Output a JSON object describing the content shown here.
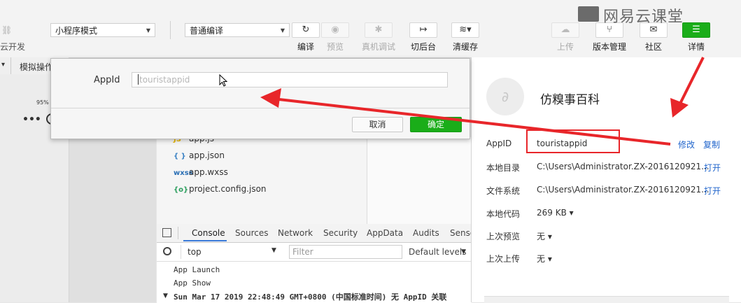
{
  "toolbar": {
    "left_partial_label": "云开发",
    "mode_select": "小程序模式",
    "compile_select": "普通编译",
    "buttons": [
      {
        "label": "编译",
        "icon": "refresh-icon",
        "disabled": false
      },
      {
        "label": "预览",
        "icon": "eye-icon",
        "disabled": true
      },
      {
        "label": "真机调试",
        "icon": "bug-icon",
        "disabled": true
      },
      {
        "label": "切后台",
        "icon": "switch-icon",
        "disabled": false
      },
      {
        "label": "清缓存",
        "icon": "layers-icon",
        "disabled": false
      }
    ],
    "right_buttons": [
      {
        "label": "上传",
        "icon": "cloud-upload-icon",
        "disabled": true
      },
      {
        "label": "版本管理",
        "icon": "branch-icon",
        "disabled": false
      },
      {
        "label": "社区",
        "icon": "chat-icon",
        "disabled": false
      },
      {
        "label": "详情",
        "icon": "menu-icon",
        "disabled": false
      }
    ]
  },
  "watermark": "网易云课堂",
  "simulator": {
    "ops_label": "模拟操作",
    "battery": "95%"
  },
  "dialog": {
    "label": "AppId",
    "placeholder": "touristappid",
    "cancel": "取消",
    "confirm": "确定"
  },
  "files": [
    {
      "icon": "JS",
      "name": "app.js",
      "color": "#e8b500"
    },
    {
      "icon": "{ }",
      "name": "app.json",
      "color": "#3b82c4"
    },
    {
      "icon": "wxss",
      "name": "app.wxss",
      "color": "#2a6fb5"
    },
    {
      "icon": "{o}",
      "name": "project.config.json",
      "color": "#2a9d5c"
    }
  ],
  "console": {
    "tabs": [
      "Console",
      "Sources",
      "Network",
      "Security",
      "AppData",
      "Audits",
      "Senso"
    ],
    "context": "top",
    "filter_placeholder": "Filter",
    "levels": "Default levels",
    "logs": [
      "App Launch",
      "App Show",
      "Sun Mar 17 2019 22:48:49 GMT+0800 (中国标准时间) 无 AppID 关联"
    ]
  },
  "details": {
    "project_name": "仿糗事百科",
    "rows": [
      {
        "label": "AppID",
        "value": "touristappid",
        "actions": [
          "修改",
          "复制"
        ]
      },
      {
        "label": "本地目录",
        "value": "C:\\Users\\Administrator.ZX-2016120921...",
        "actions": [
          "打开"
        ]
      },
      {
        "label": "文件系统",
        "value": "C:\\Users\\Administrator.ZX-2016120921...",
        "actions": [
          "打开"
        ]
      },
      {
        "label": "本地代码",
        "value": "269 KB ▾",
        "actions": []
      },
      {
        "label": "上次预览",
        "value": "无 ▾",
        "actions": []
      },
      {
        "label": "上次上传",
        "value": "无 ▾",
        "actions": []
      }
    ]
  },
  "colors": {
    "accent": "#1aad19",
    "annotation": "#e8262a",
    "link": "#2266cc"
  }
}
